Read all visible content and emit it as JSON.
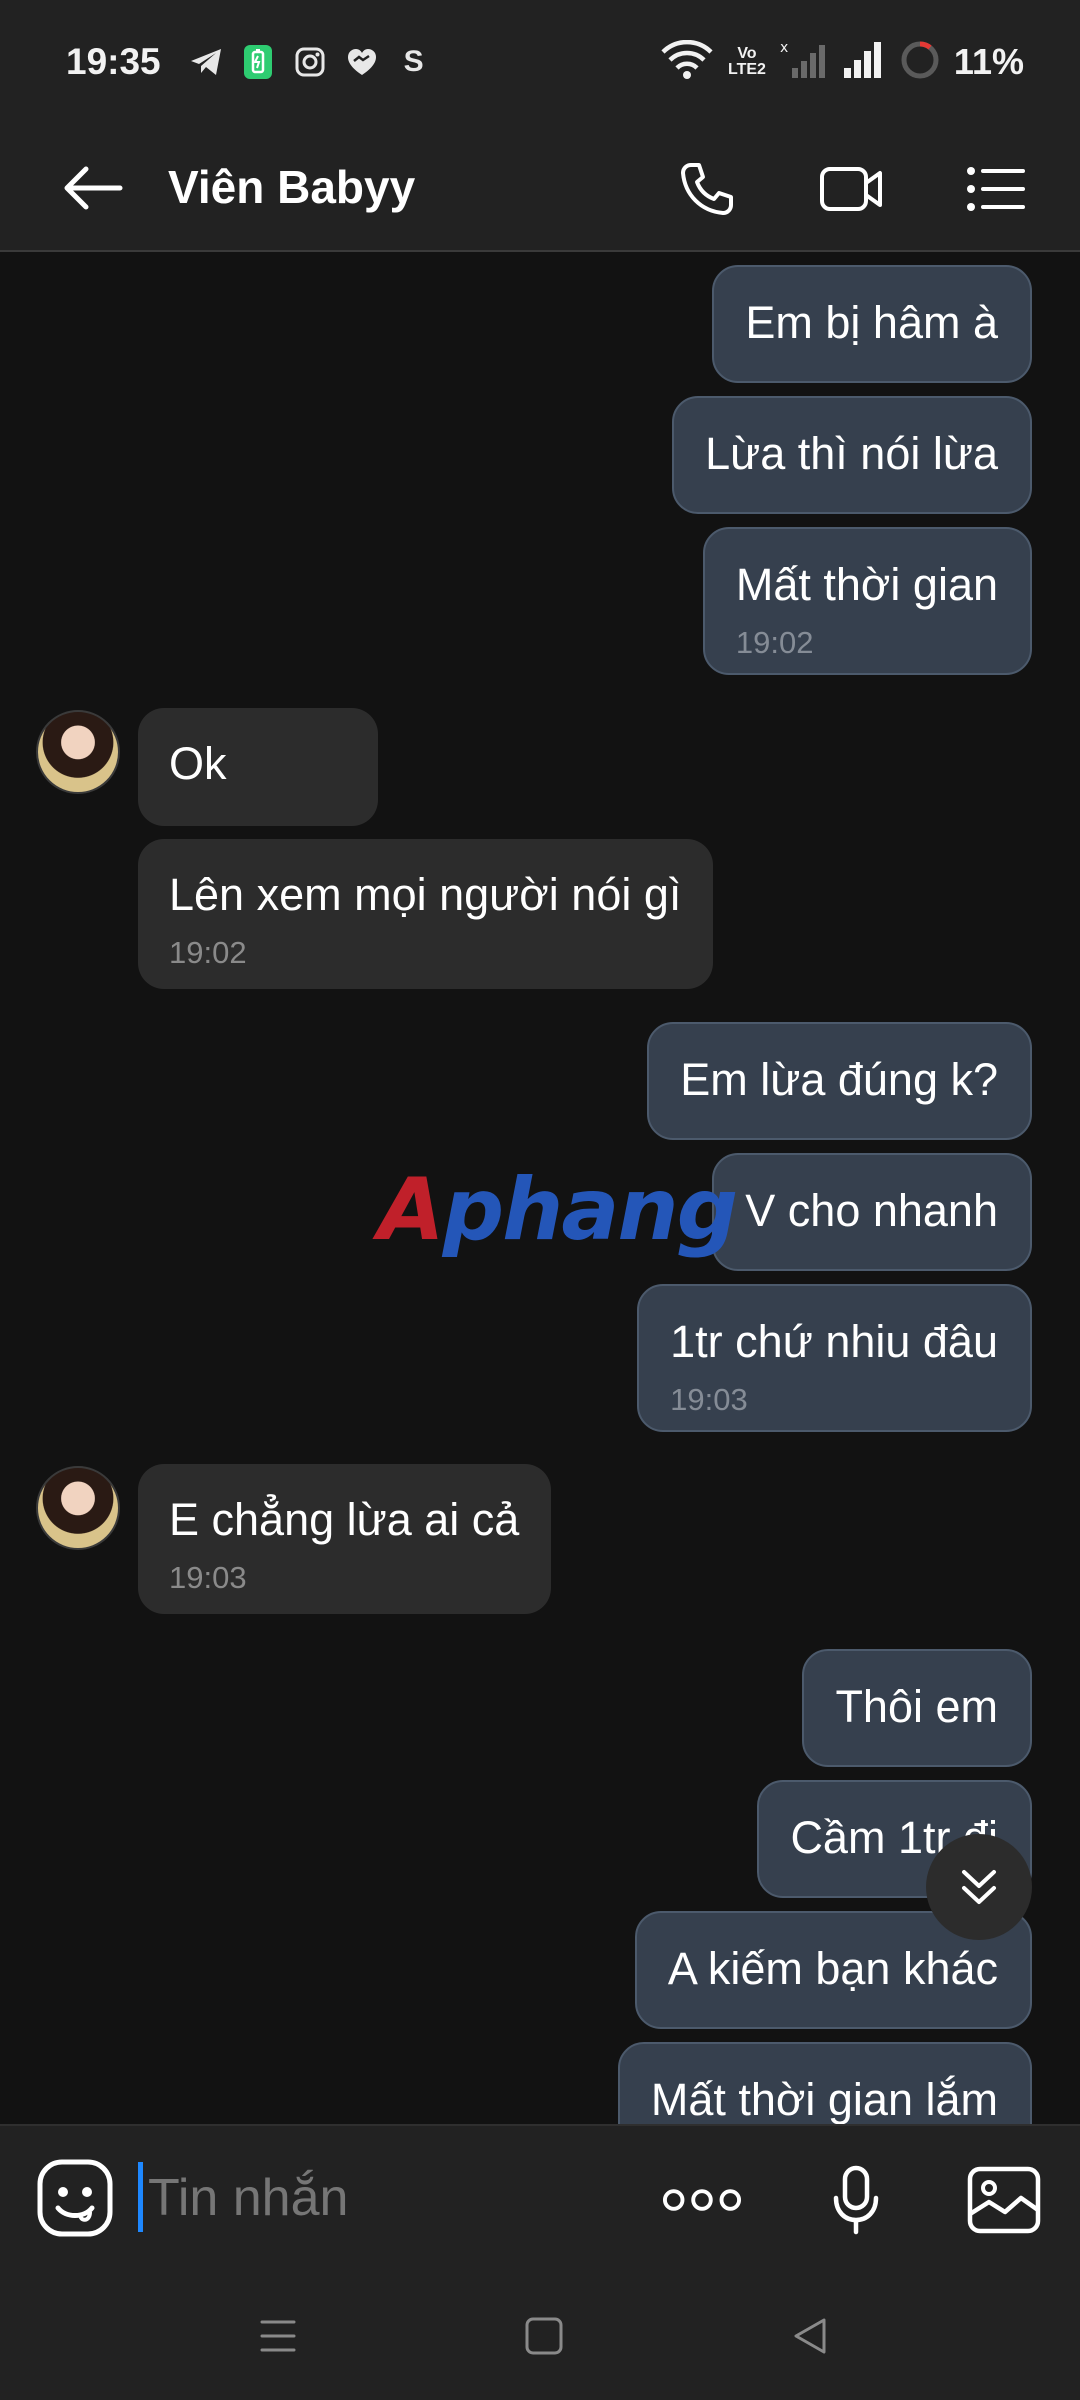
{
  "status_bar": {
    "time": "19:35",
    "volte_top": "Vo",
    "volte_bottom": "LTE2",
    "battery": "11%",
    "icons_left": [
      "telegram-icon",
      "battery-saver-icon",
      "instagram-icon",
      "messenger-icon",
      "s-app-icon"
    ],
    "icons_right": [
      "wifi-icon",
      "volte-icon",
      "signal-sim1-icon",
      "signal-sim2-icon",
      "battery-ring-icon"
    ],
    "s_app_glyph": "S"
  },
  "header": {
    "title": "Viên Babyy",
    "actions": [
      "phone-call",
      "video-call",
      "menu"
    ]
  },
  "messages": [
    {
      "side": "out",
      "text": "Em bị hâm à"
    },
    {
      "side": "out",
      "text": "Lừa thì nói lừa"
    },
    {
      "side": "out",
      "text": "Mất thời gian",
      "time": "19:02"
    },
    {
      "side": "in",
      "text": "Ok"
    },
    {
      "side": "in",
      "text": "Lên xem mọi người nói gì",
      "time": "19:02"
    },
    {
      "side": "out",
      "text": "Em lừa đúng k?"
    },
    {
      "side": "out",
      "text": "V cho nhanh"
    },
    {
      "side": "out",
      "text": "1tr chứ nhiu đâu",
      "time": "19:03"
    },
    {
      "side": "in",
      "text": "E chẳng lừa ai cả",
      "time": "19:03"
    },
    {
      "side": "out",
      "text": "Thôi em"
    },
    {
      "side": "out",
      "text": "Cầm 1tr đi"
    },
    {
      "side": "out",
      "text": "A kiếm bạn khác"
    },
    {
      "side": "out",
      "text": "Mất thời gian lắm"
    }
  ],
  "watermark": {
    "first": "A",
    "rest": "phang"
  },
  "input": {
    "placeholder": "Tin nhắn",
    "value": ""
  },
  "colors": {
    "background": "#121212",
    "bar": "#222222",
    "outgoing_bubble": "#36404e",
    "incoming_bubble": "#2c2c2c",
    "cursor": "#1e88ff"
  }
}
